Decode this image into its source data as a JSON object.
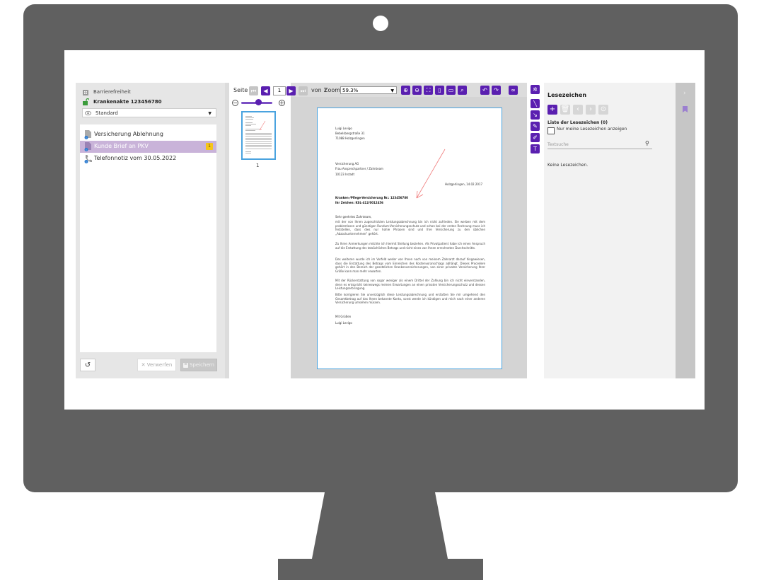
{
  "left_panel": {
    "accessibility_label": "Barrierefreiheit",
    "record_title": "Krankenakte 123456780",
    "view_select": "Standard",
    "documents": [
      {
        "label": "Versicherung Ablehnung",
        "selected": false,
        "badge": ""
      },
      {
        "label": "Kunde Brief an PKV",
        "selected": true,
        "badge": "1"
      },
      {
        "label": "Telefonnotiz vom 30.05.2022",
        "selected": false,
        "badge": ""
      }
    ],
    "discard_label": "✕ Verwerfen",
    "save_label": "Speichern"
  },
  "toolbar": {
    "page_label": "Seite",
    "page_value": "1",
    "of_label": "von 1",
    "zoom_label": "Zoom",
    "zoom_value": "59.3%"
  },
  "thumbnails": {
    "page_number": "1"
  },
  "document": {
    "sender_name": "Luigi Levigo",
    "sender_street": "Bebelsbergstraße 31",
    "sender_city": "71088 Holzgerlingen",
    "recipient_company": "Versicherung AG",
    "recipient_contact": "Frau Ansprechpartner / Zahnteam",
    "recipient_city": "10123 Irstadt",
    "date_line": "Holzgerlingen, 14.02.2017",
    "subject_1": "Kranken-/Pflege-Versicherung Nr.: 123456780",
    "subject_2": "Ihr Zeichen: KSL-412/0012456",
    "salutation": "Sehr geehrtes Zahnteam,",
    "para_1": "mit der von Ihnen zugeschickten Leistungsabrechnung bin ich nicht zufrieden. Sie werben mit dem problemlosen und günstigen Rundum-Versicherungsschutz und schon bei der ersten Rechnung muss ich feststellen, dass dies nur hohle Phrasen sind und Ihre Versicherung zu den üblichen „Abzockunternehmen\" gehört.",
    "para_2": "Zu Ihren Anmerkungen möchte ich hiermit Stellung beziehen. Als Privatpatient habe ich einen Anspruch auf die Erstattung des tatsächlichen Betrags und nicht eines von Ihnen errechneten Durchschnitts.",
    "para_3": "Des weiteren wurde ich im Vorfeld weder von Ihnen noch von meinem Zahnarzt darauf hingewiesen, dass die Erstattung des Betrags vom Einreichen des Kostenvoranschlags abhängt. Dieses Procedere gehört in den Bereich der gesetzlichen Krankenversicherungen, von einer privaten Versicherung Ihrer Größe kann man mehr erwarten.",
    "para_4": "Mit der Rückerstattung von sogar weniger als einem Drittel der Zahlung bin ich nicht einverstanden, denn es entspricht keineswegs meinen Erwartungen an einen privaten Versicherungsschutz und dessen Leistungserbringung.",
    "para_5": "Bitte korrigieren Sie unverzüglich diese Leistungsabrechnung und erstatten Sie mir umgehend den Gesamtbetrag auf das Ihnen bekannte Konto, sonst werde ich kündigen und mich nach einer anderen Versicherung umsehen müssen.",
    "closing": "Mit Grüßen",
    "signature": "Luigi Levigo"
  },
  "bookmarks": {
    "title": "Lesezeichen",
    "list_label": "Liste der Lesezeichen (0)",
    "only_mine_label": "Nur meine Lesezeichen anzeigen",
    "search_placeholder": "Textsuche",
    "empty_text": "Keine Lesezeichen."
  },
  "colors": {
    "accent": "#5a1fb0",
    "selection": "#c9b3d9",
    "badge": "#f5c518",
    "monitor": "#606060",
    "annotation": "#f07a7a"
  }
}
